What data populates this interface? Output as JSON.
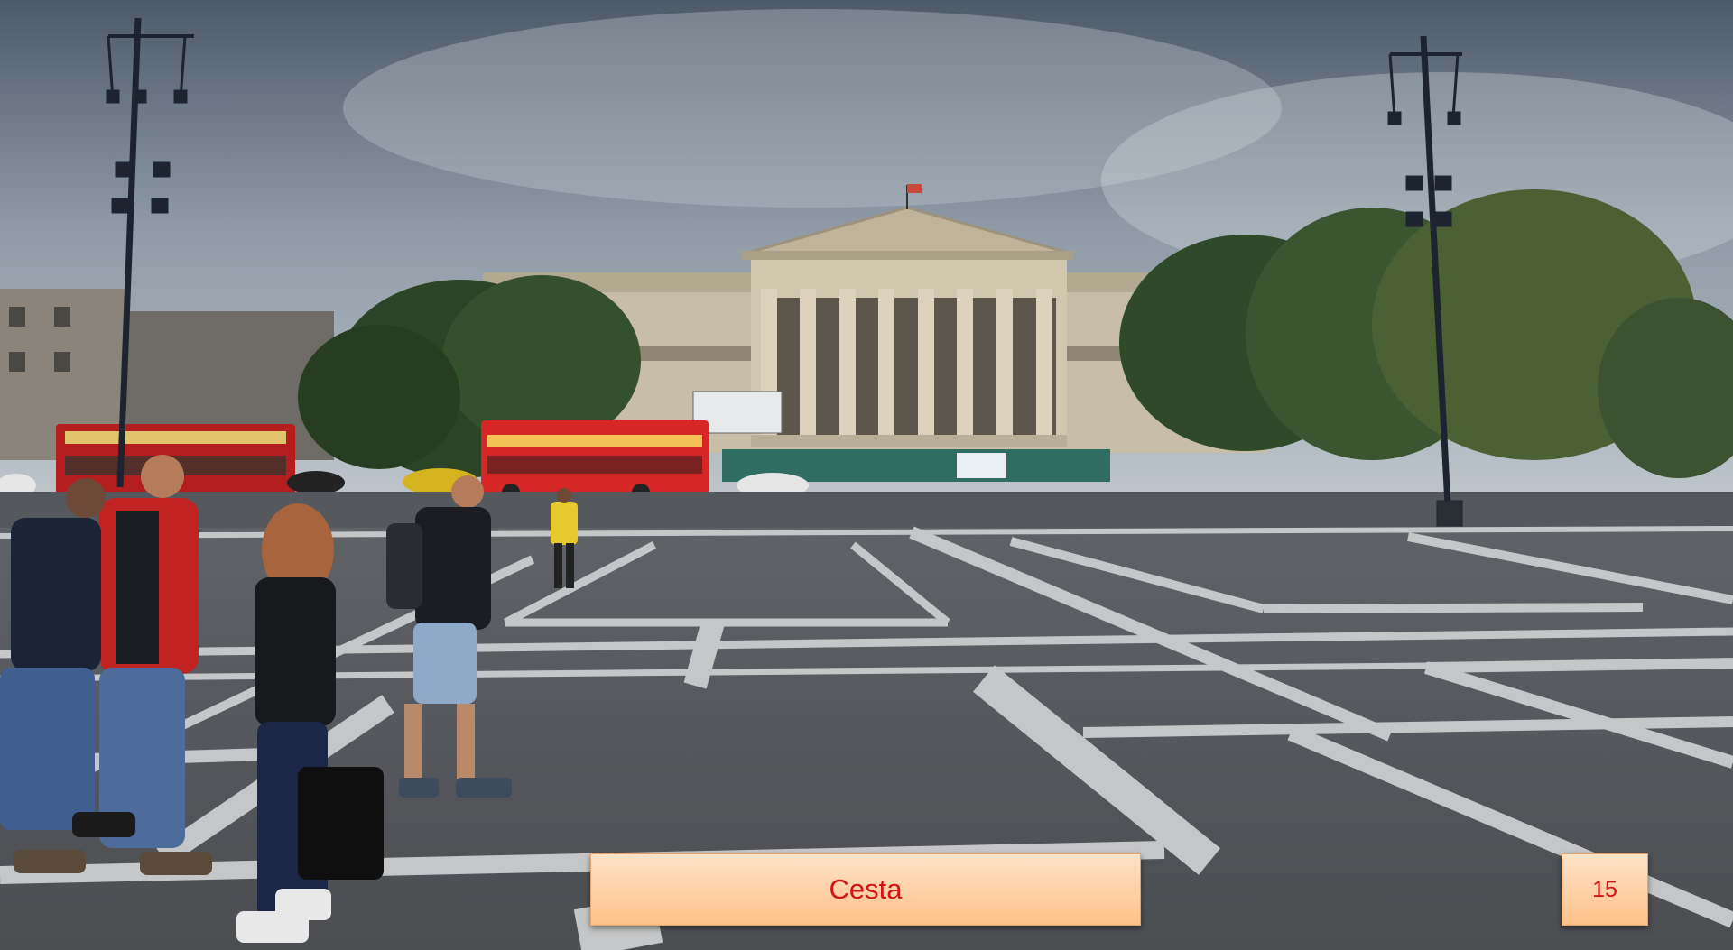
{
  "slide": {
    "caption": "Cesta",
    "page_number": "15"
  },
  "colors": {
    "caption_text": "#d41414",
    "box_top": "#fde3c8",
    "box_bottom": "#ffc189"
  }
}
